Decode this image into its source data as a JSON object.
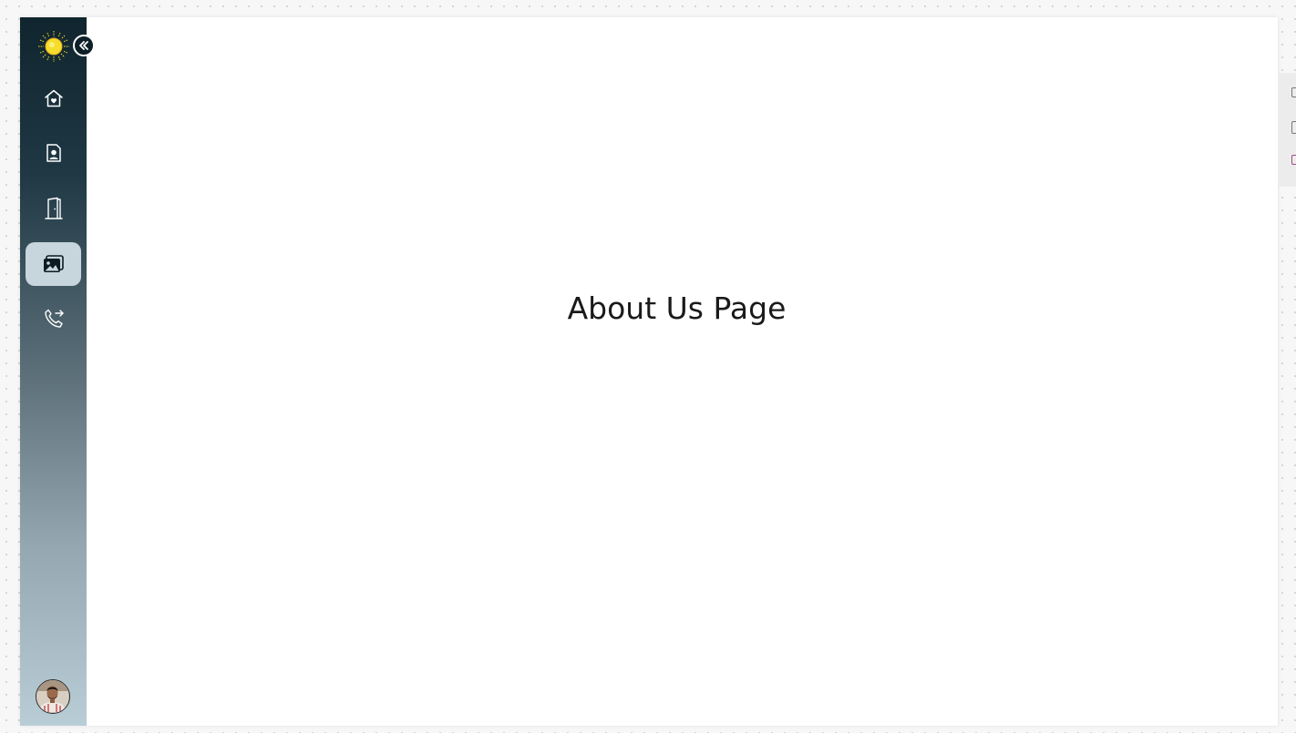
{
  "main": {
    "title": "About Us Page"
  },
  "sidebar": {
    "logo_icon": "sun-logo-icon",
    "collapse_icon": "chevrons-left-icon",
    "items": [
      {
        "icon": "home-heart-icon",
        "active": false
      },
      {
        "icon": "profile-document-icon",
        "active": false
      },
      {
        "icon": "door-icon",
        "active": false
      },
      {
        "icon": "gallery-icon",
        "active": true
      },
      {
        "icon": "phone-forward-icon",
        "active": false
      }
    ],
    "avatar": "user-avatar"
  },
  "colors": {
    "sidebar_top": "#10252e",
    "sidebar_bottom": "#b9cdd6",
    "active_item": "#c7d5dc",
    "logo_yellow": "#f6dd2b"
  }
}
